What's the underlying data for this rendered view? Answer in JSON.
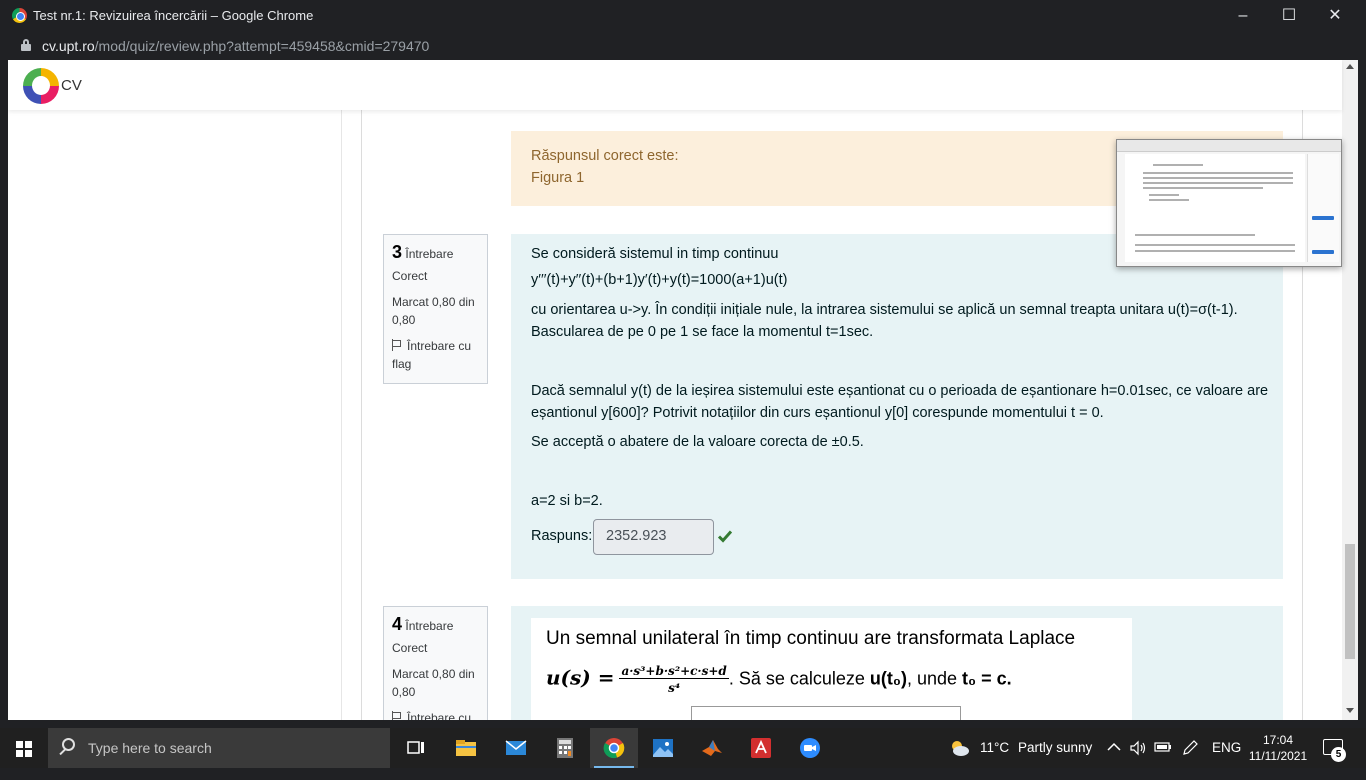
{
  "window": {
    "title": "Test nr.1: Revizuirea încercării – Google Chrome",
    "url_host": "cv.upt.ro",
    "url_path": "/mod/quiz/review.php?attempt=459458&cmid=279470"
  },
  "site": {
    "logo_text": "CV"
  },
  "prev_feedback": {
    "label": "Răspunsul corect este:",
    "value": "Figura 1"
  },
  "q3": {
    "number": "3",
    "word": "Întrebare",
    "state": "Corect",
    "grade": "Marcat 0,80 din 0,80",
    "flag": "Întrebare cu flag",
    "line1": "Se consideră sistemul in timp continuu",
    "line2": "y′′′(t)+y′′(t)+(b+1)y′(t)+y(t)=1000(a+1)u(t)",
    "line3": "cu orientarea u->y. În condiții inițiale nule, la intrarea sistemului se aplică un semnal treapta unitara u(t)=σ(t-1). Bascularea de pe 0 pe 1 se face la momentul t=1sec.",
    "line4": "Dacă semnalul y(t) de la ieșirea sistemului este eșantionat cu o perioada de eșantionare h=0.01sec, ce valoare are eșantionul y[600]?  Potrivit notațiilor din curs eșantionul y[0] corespunde momentului t = 0.",
    "line5": "Se acceptă o abatere de la valoare corecta de ±0.5.",
    "line6": "a=2 si b=2.",
    "answer_label": "Raspuns:",
    "answer_value": "2352.923"
  },
  "q4": {
    "number": "4",
    "word": "Întrebare",
    "state": "Corect",
    "grade": "Marcat 0,80 din 0,80",
    "flag": "Întrebare cu",
    "text1": "Un semnal unilateral în timp continuu are transformata Laplace",
    "formula_lhs": "u(s) =",
    "formula_num": "a·s³+b·s²+c·s+d",
    "formula_den": "s⁴",
    "text2a": ". Să se calculeze ",
    "text2b": "u(t₀)",
    "text2c": ", unde ",
    "text2d": "t₀ = c."
  },
  "taskbar": {
    "search_placeholder": "Type here to search",
    "weather_temp": "11°C",
    "weather_desc": "Partly sunny",
    "lang": "ENG",
    "time": "17:04",
    "date": "11/11/2021",
    "notif_count": "5"
  },
  "colors": {
    "info_bg": "#e7f3f5",
    "correct_bg": "#fcefdc",
    "correct_text": "#8e662e",
    "check": "#357a32"
  }
}
